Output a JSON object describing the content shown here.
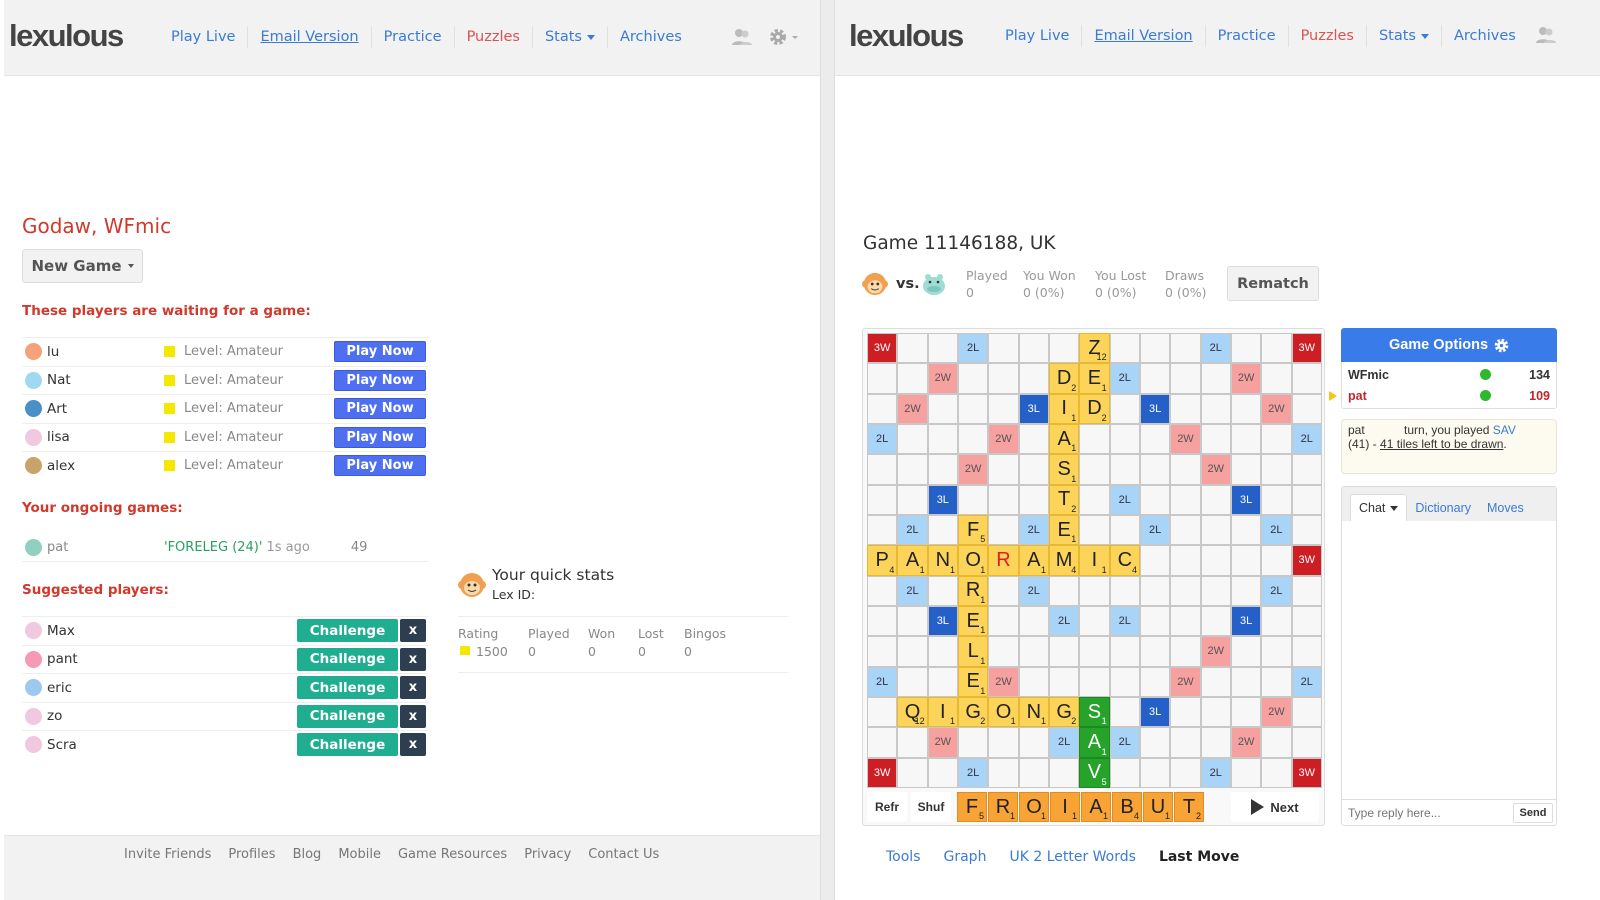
{
  "left": {
    "logo": "lexulous",
    "nav": [
      {
        "label": "Play Live",
        "style": "plain"
      },
      {
        "label": "Email Version",
        "style": "underline"
      },
      {
        "label": "Practice",
        "style": "plain"
      },
      {
        "label": "Puzzles",
        "style": "red"
      },
      {
        "label": "Stats",
        "style": "dropdown"
      },
      {
        "label": "Archives",
        "style": "plain"
      }
    ],
    "greeting": "Godaw, WFmic",
    "new_game_label": "New Game",
    "waiting_heading": "These players are waiting for a game:",
    "waiting_players": [
      {
        "name": "lu",
        "level": "Level: Amateur",
        "avatar_color": "#f5a27a"
      },
      {
        "name": "Nat",
        "level": "Level: Amateur",
        "avatar_color": "#9fd8f0"
      },
      {
        "name": "Art",
        "level": "Level: Amateur",
        "avatar_color": "#4b8fc8"
      },
      {
        "name": "lisa",
        "level": "Level: Amateur",
        "avatar_color": "#f0c8e0"
      },
      {
        "name": "alex",
        "level": "Level: Amateur",
        "avatar_color": "#c9a46a"
      }
    ],
    "play_now_label": "Play Now",
    "ongoing_heading": "Your ongoing games:",
    "ongoing": {
      "name": "pat",
      "last_word": "'FORELEG (24)'",
      "time": "1s ago",
      "score": "49",
      "avatar_color": "#8fd0c0"
    },
    "suggested_heading": "Suggested players:",
    "suggested_players": [
      {
        "name": "Max",
        "avatar_color": "#f0c8e0"
      },
      {
        "name": "pant",
        "avatar_color": "#f59ab5"
      },
      {
        "name": "eric",
        "avatar_color": "#9fc8f0"
      },
      {
        "name": "zo",
        "avatar_color": "#f0c8e0"
      },
      {
        "name": "Scra",
        "avatar_color": "#f0c8e0"
      }
    ],
    "challenge_label": "Challenge",
    "dismiss_label": "x",
    "quick_stats": {
      "title": "Your quick stats",
      "lex_id": "Lex ID:",
      "columns": [
        "Rating",
        "Played",
        "Won",
        "Lost",
        "Bingos"
      ],
      "values": [
        "1500",
        "0",
        "0",
        "0",
        "0"
      ]
    },
    "footer_links": [
      "Invite Friends",
      "Profiles",
      "Blog",
      "Mobile",
      "Game Resources",
      "Privacy",
      "Contact Us"
    ]
  },
  "right": {
    "logo": "lexulous",
    "nav": [
      {
        "label": "Play Live",
        "style": "plain"
      },
      {
        "label": "Email Version",
        "style": "underline"
      },
      {
        "label": "Practice",
        "style": "plain"
      },
      {
        "label": "Puzzles",
        "style": "red"
      },
      {
        "label": "Stats",
        "style": "dropdown"
      },
      {
        "label": "Archives",
        "style": "plain"
      }
    ],
    "game_title": "Game 11146188, UK",
    "vs_label": "vs.",
    "head_to_head": [
      {
        "label": "Played",
        "value": "0"
      },
      {
        "label": "You Won",
        "value": "0 (0%)"
      },
      {
        "label": "You Lost",
        "value": "0 (0%)"
      },
      {
        "label": "Draws",
        "value": "0 (0%)"
      }
    ],
    "rematch_label": "Rematch",
    "board": {
      "premiums": {
        "3W": [
          [
            0,
            0
          ],
          [
            0,
            14
          ],
          [
            7,
            14
          ],
          [
            14,
            0
          ],
          [
            14,
            14
          ]
        ],
        "2W": [
          [
            1,
            2
          ],
          [
            1,
            12
          ],
          [
            2,
            1
          ],
          [
            2,
            13
          ],
          [
            3,
            4
          ],
          [
            3,
            10
          ],
          [
            4,
            3
          ],
          [
            4,
            11
          ],
          [
            10,
            11
          ],
          [
            11,
            4
          ],
          [
            11,
            10
          ],
          [
            12,
            13
          ],
          [
            13,
            2
          ],
          [
            13,
            12
          ]
        ],
        "3L": [
          [
            2,
            5
          ],
          [
            2,
            9
          ],
          [
            5,
            2
          ],
          [
            5,
            12
          ],
          [
            9,
            2
          ],
          [
            9,
            12
          ],
          [
            12,
            9
          ]
        ],
        "2L": [
          [
            0,
            3
          ],
          [
            0,
            11
          ],
          [
            1,
            8
          ],
          [
            3,
            0
          ],
          [
            3,
            14
          ],
          [
            5,
            8
          ],
          [
            6,
            1
          ],
          [
            6,
            5
          ],
          [
            6,
            9
          ],
          [
            6,
            13
          ],
          [
            8,
            1
          ],
          [
            8,
            5
          ],
          [
            8,
            13
          ],
          [
            9,
            6
          ],
          [
            9,
            8
          ],
          [
            11,
            0
          ],
          [
            11,
            14
          ],
          [
            13,
            6
          ],
          [
            13,
            8
          ],
          [
            14,
            3
          ],
          [
            14,
            11
          ]
        ]
      },
      "tiles": [
        {
          "r": 0,
          "c": 7,
          "l": "Z",
          "p": "12"
        },
        {
          "r": 1,
          "c": 6,
          "l": "D",
          "p": "2"
        },
        {
          "r": 1,
          "c": 7,
          "l": "E",
          "p": "1"
        },
        {
          "r": 2,
          "c": 6,
          "l": "I",
          "p": "1"
        },
        {
          "r": 2,
          "c": 7,
          "l": "D",
          "p": "2"
        },
        {
          "r": 3,
          "c": 6,
          "l": "A",
          "p": "1"
        },
        {
          "r": 4,
          "c": 6,
          "l": "S",
          "p": "1"
        },
        {
          "r": 5,
          "c": 6,
          "l": "T",
          "p": "2"
        },
        {
          "r": 6,
          "c": 3,
          "l": "F",
          "p": "5"
        },
        {
          "r": 6,
          "c": 6,
          "l": "E",
          "p": "1"
        },
        {
          "r": 7,
          "c": 0,
          "l": "P",
          "p": "4"
        },
        {
          "r": 7,
          "c": 1,
          "l": "A",
          "p": "1"
        },
        {
          "r": 7,
          "c": 2,
          "l": "N",
          "p": "1"
        },
        {
          "r": 7,
          "c": 3,
          "l": "O",
          "p": "1"
        },
        {
          "r": 7,
          "c": 4,
          "l": "R",
          "p": "",
          "blank": true
        },
        {
          "r": 7,
          "c": 5,
          "l": "A",
          "p": "1"
        },
        {
          "r": 7,
          "c": 6,
          "l": "M",
          "p": "4"
        },
        {
          "r": 7,
          "c": 7,
          "l": "I",
          "p": "1"
        },
        {
          "r": 7,
          "c": 8,
          "l": "C",
          "p": "4"
        },
        {
          "r": 8,
          "c": 3,
          "l": "R",
          "p": "1"
        },
        {
          "r": 9,
          "c": 3,
          "l": "E",
          "p": "1"
        },
        {
          "r": 10,
          "c": 3,
          "l": "L",
          "p": "1"
        },
        {
          "r": 11,
          "c": 3,
          "l": "E",
          "p": "1"
        },
        {
          "r": 12,
          "c": 1,
          "l": "Q",
          "p": "12"
        },
        {
          "r": 12,
          "c": 2,
          "l": "I",
          "p": "1"
        },
        {
          "r": 12,
          "c": 3,
          "l": "G",
          "p": "2"
        },
        {
          "r": 12,
          "c": 4,
          "l": "O",
          "p": "1"
        },
        {
          "r": 12,
          "c": 5,
          "l": "N",
          "p": "1"
        },
        {
          "r": 12,
          "c": 6,
          "l": "G",
          "p": "2"
        },
        {
          "r": 12,
          "c": 7,
          "l": "S",
          "p": "1",
          "new": true
        },
        {
          "r": 13,
          "c": 7,
          "l": "A",
          "p": "1",
          "new": true
        },
        {
          "r": 14,
          "c": 7,
          "l": "V",
          "p": "5",
          "new": true
        }
      ]
    },
    "rack": [
      {
        "l": "F",
        "p": "5"
      },
      {
        "l": "R",
        "p": "1"
      },
      {
        "l": "O",
        "p": "1"
      },
      {
        "l": "I",
        "p": "1"
      },
      {
        "l": "A",
        "p": "1"
      },
      {
        "l": "B",
        "p": "4"
      },
      {
        "l": "U",
        "p": "1"
      },
      {
        "l": "T",
        "p": "2"
      }
    ],
    "refresh_label": "Refr",
    "shuffle_label": "Shuf",
    "next_label": "Next",
    "bottom_tabs": [
      {
        "label": "Tools",
        "active": false
      },
      {
        "label": "Graph",
        "active": false
      },
      {
        "label": "UK 2 Letter Words",
        "active": false
      },
      {
        "label": "Last Move",
        "active": true
      }
    ],
    "game_options_label": "Game Options",
    "players": [
      {
        "name": "WFmic",
        "score": "134",
        "color": "#222",
        "turn": false
      },
      {
        "name": "pat",
        "score": "109",
        "color": "#c0262d",
        "turn": true
      }
    ],
    "message": {
      "prefix": "pat",
      "middle": "turn, you played",
      "word": "SAV",
      "score": "(41) -",
      "tiles_left": "41 tiles left to be drawn",
      "suffix": "."
    },
    "chat_tabs": [
      {
        "label": "Chat",
        "active": true
      },
      {
        "label": "Dictionary",
        "active": false
      },
      {
        "label": "Moves",
        "active": false
      }
    ],
    "chat_placeholder": "Type reply here...",
    "send_label": "Send"
  },
  "colors": {
    "link": "#3a7bd5",
    "heading_red": "#d0392b",
    "play_now": "#4e6ff0",
    "challenge": "#1fae8f",
    "tile": "#fcd45a",
    "rack_tile": "#f7a336",
    "new_tile": "#27a22b",
    "triple_word": "#cc1e23",
    "double_word": "#f7a0a0",
    "triple_letter": "#2460c8",
    "double_letter": "#a8d4f8"
  }
}
